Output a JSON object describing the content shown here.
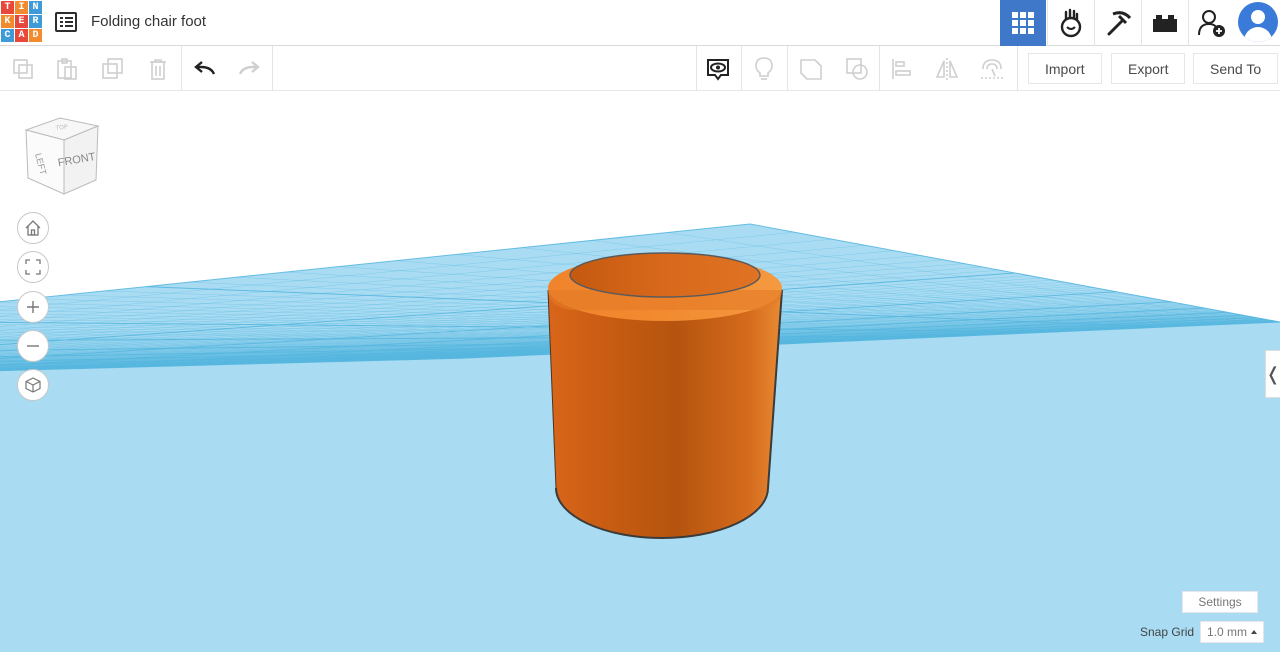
{
  "app": {
    "logo_letters": [
      "T",
      "I",
      "N",
      "K",
      "E",
      "R",
      "C",
      "A",
      "D"
    ],
    "logo_colors": [
      "#e8473b",
      "#f18b2d",
      "#3e9bd7",
      "#f18b2d",
      "#e8473b",
      "#3e9bd7",
      "#3e9bd7",
      "#e8473b",
      "#f18b2d"
    ],
    "design_title": "Folding chair foot"
  },
  "header": {
    "buttons": [
      {
        "name": "3d-design-grid-icon",
        "active": true
      },
      {
        "name": "circuits-icon",
        "active": false
      },
      {
        "name": "codeblocks-pickaxe-icon",
        "active": false
      },
      {
        "name": "bricks-icon",
        "active": false
      },
      {
        "name": "add-user-icon",
        "active": false
      }
    ],
    "active_color": "#3f78c9"
  },
  "toolbar": {
    "edit_icons": [
      "copy-icon",
      "paste-icon",
      "duplicate-icon",
      "delete-icon",
      "undo-icon",
      "redo-icon"
    ],
    "view_icons": [
      "show-all-icon",
      "notes-light-icon",
      "group-icon",
      "ungroup-icon",
      "align-icon",
      "mirror-icon",
      "cruise-icon"
    ],
    "import_label": "Import",
    "export_label": "Export",
    "send_to_label": "Send To"
  },
  "viewcube": {
    "front_label": "FRONT",
    "left_label": "LEFT",
    "top_label": "TOP"
  },
  "nav_controls": [
    "home-view-icon",
    "fit-all-icon",
    "zoom-in-icon",
    "zoom-out-icon",
    "perspective-icon"
  ],
  "workplane": {
    "grid_color": "#57b7df",
    "plane_color": "#a9dcf3",
    "shape_color": "#e2721f"
  },
  "bottom": {
    "settings_label": "Settings",
    "snap_grid_label": "Snap Grid",
    "snap_grid_value": "1.0 mm"
  }
}
